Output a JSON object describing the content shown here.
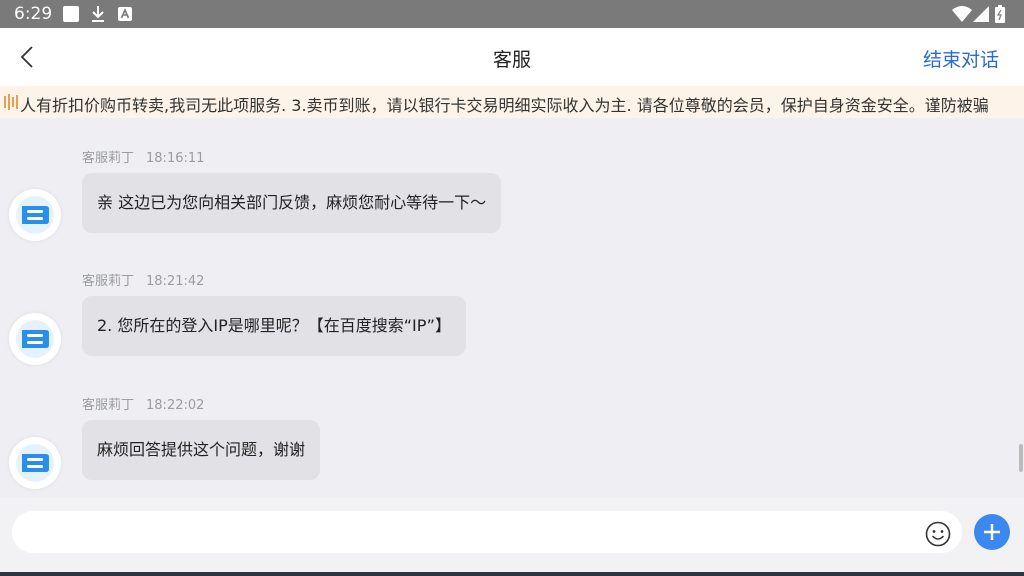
{
  "status_bar": {
    "time": "6:29",
    "icons": [
      "notification-square-icon",
      "download-icon",
      "a-badge-icon",
      "wifi-icon",
      "signal-icon",
      "battery-icon"
    ]
  },
  "header": {
    "title": "客服",
    "end_label": "结束对话",
    "accent_color": "#2a6bd3"
  },
  "notice": {
    "text": "人有折扣价购币转卖,我司无此项服务. 3.卖币到账，请以银行卡交易明细实际收入为主. 请各位尊敬的会员，保护自身资金安全。谨防被骗"
  },
  "messages": [
    {
      "sender": "客服莉丁",
      "time": "18:16:11",
      "text": "亲 这边已为您向相关部门反馈，麻烦您耐心等待一下～"
    },
    {
      "sender": "客服莉丁",
      "time": "18:21:42",
      "text": "2. 您所在的登入IP是哪里呢？【在百度搜索“IP”】"
    },
    {
      "sender": "客服莉丁",
      "time": "18:22:02",
      "text": "麻烦回答提供这个问题，谢谢"
    }
  ],
  "input": {
    "placeholder": "",
    "value": ""
  }
}
